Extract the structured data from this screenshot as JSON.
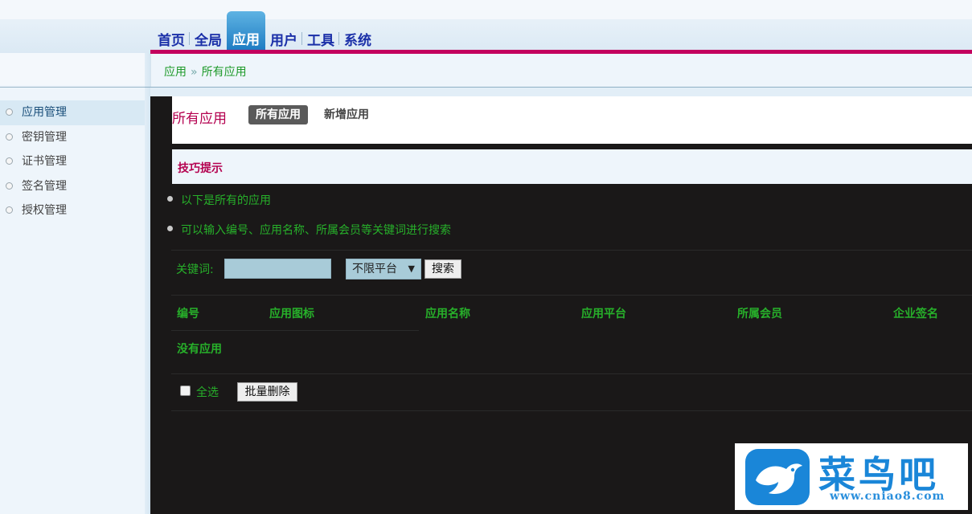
{
  "topnav": {
    "items": [
      "首页",
      "全局",
      "应用",
      "用户",
      "工具",
      "系统"
    ],
    "active_index": 2
  },
  "breadcrumb": {
    "root": "应用",
    "separator": "»",
    "current": "所有应用"
  },
  "sidebar": {
    "items": [
      {
        "label": "应用管理",
        "active": true
      },
      {
        "label": "密钥管理",
        "active": false
      },
      {
        "label": "证书管理",
        "active": false
      },
      {
        "label": "签名管理",
        "active": false
      },
      {
        "label": "授权管理",
        "active": false
      }
    ]
  },
  "main": {
    "title": "所有应用",
    "tabs": [
      {
        "label": "所有应用",
        "active": true
      },
      {
        "label": "新增应用",
        "active": false
      }
    ],
    "tips": {
      "title": "技巧提示",
      "items": [
        "以下是所有的应用",
        "可以输入编号、应用名称、所属会员等关键词进行搜索"
      ]
    },
    "search": {
      "label": "关键词:",
      "value": "",
      "platform_selected": "不限平台",
      "button": "搜索"
    },
    "table": {
      "columns": [
        "编号",
        "应用图标",
        "应用名称",
        "应用平台",
        "所属会员",
        "企业签名"
      ],
      "empty_message": "没有应用"
    },
    "footer": {
      "select_all_label": "全选",
      "select_all_checked": false,
      "bulk_delete_button": "批量删除"
    }
  },
  "watermark": {
    "name": "菜鸟吧",
    "url": "www.cniao8.com"
  },
  "colors": {
    "nav_text": "#1a2fa8",
    "accent_magenta": "#c3005e",
    "title_magenta": "#b4004f",
    "green_text": "#27b02a",
    "panel_dark": "#1a1818",
    "light_blue_bg": "#eef5fb",
    "input_bg": "#a8cbd8",
    "logo_blue": "#1a86d8"
  }
}
